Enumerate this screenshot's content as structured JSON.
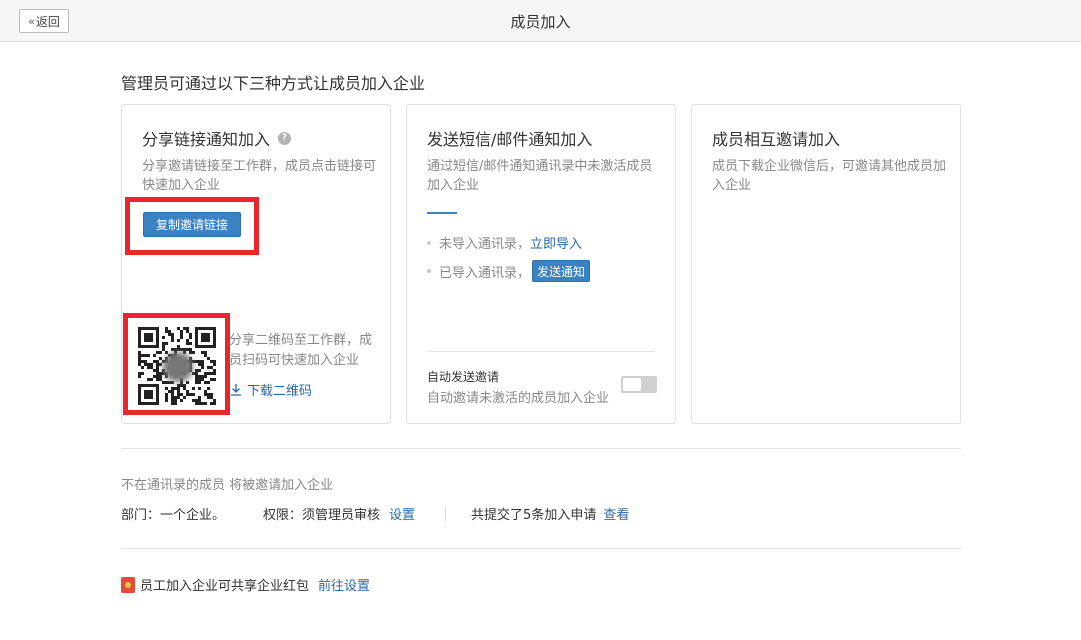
{
  "header": {
    "back_label": "返回",
    "title": "成员加入"
  },
  "intro": "管理员可通过以下三种方式让成员加入企业",
  "card1": {
    "title": "分享链接通知加入",
    "desc": "分享邀请链接至工作群，成员点击链接可快速加入企业",
    "copy_button": "复制邀请链接",
    "qr_desc": "分享二维码至工作群，成员扫码可快速加入企业",
    "download_link": "下载二维码"
  },
  "card2": {
    "title": "发送短信/邮件通知加入",
    "desc": "通过短信/邮件通知通讯录中未激活成员加入企业",
    "item1_text": "未导入通讯录，",
    "item1_link": "立即导入",
    "item2_text": "已导入通讯录，",
    "item2_button": "发送通知",
    "auto_title": "自动发送邀请",
    "auto_desc": "自动邀请未激活的成员加入企业",
    "auto_enabled": false
  },
  "card3": {
    "title": "成员相互邀请加入",
    "desc": "成员下载企业微信后，可邀请其他成员加入企业"
  },
  "footer": {
    "note": "不在通讯录的成员 将被邀请加入企业",
    "dept": "部门：一个企业。",
    "perm_label": "权限：须管理员审核",
    "perm_link": "设置",
    "apply_text": "共提交了5条加入申请",
    "apply_link": "查看",
    "redpacket_text": "员工加入企业可共享企业红包",
    "redpacket_link": "前往设置"
  },
  "colors": {
    "accent": "#3b82c4",
    "link": "#2a69a8",
    "highlight": "#e8262b"
  }
}
